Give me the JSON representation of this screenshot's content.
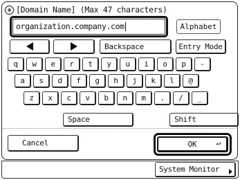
{
  "title": {
    "icon": "globe-icon",
    "text": "[Domain Name] (Max 47 characters)"
  },
  "input": {
    "value": "organization.company.com"
  },
  "mode_indicator": "Alphabet",
  "top_row": {
    "left_arrow_icon": "left-arrow-icon",
    "right_arrow_icon": "right-arrow-icon",
    "backspace": "Backspace",
    "entry_mode": "Entry Mode"
  },
  "rows": [
    [
      "q",
      "w",
      "e",
      "r",
      "t",
      "y",
      "u",
      "i",
      "o",
      "p",
      "-"
    ],
    [
      "a",
      "s",
      "d",
      "f",
      "g",
      "h",
      "j",
      "k",
      "l",
      "@"
    ],
    [
      "z",
      "x",
      "c",
      "v",
      "b",
      "n",
      "m",
      ".",
      "/",
      "_"
    ]
  ],
  "space": "Space",
  "shift": "Shift",
  "cancel": "Cancel",
  "ok": "OK",
  "ok_enter_symbol": "↵",
  "system_monitor": "System Monitor"
}
